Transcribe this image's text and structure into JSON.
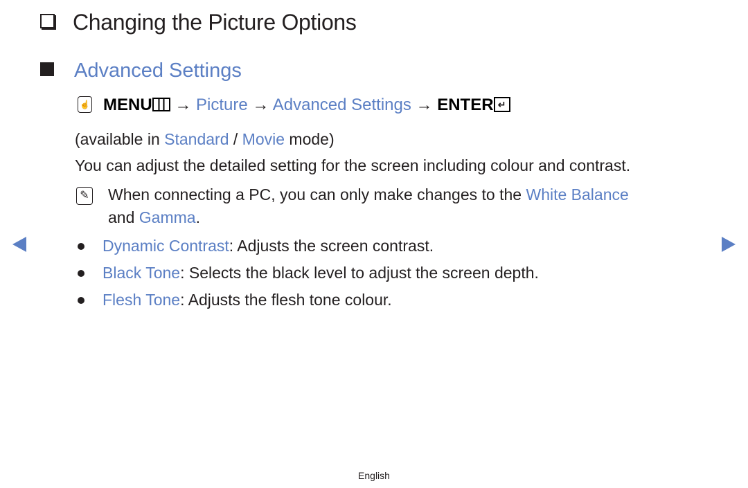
{
  "title": "Changing the Picture Options",
  "section": "Advanced Settings",
  "menu_path": {
    "menu": "MENU",
    "arrow": "→",
    "picture": "Picture",
    "advanced": "Advanced Settings",
    "enter": "ENTER",
    "enter_glyph": "↵",
    "hand_glyph": "☝"
  },
  "availability": {
    "prefix": "(available in ",
    "mode1": "Standard",
    "sep": " / ",
    "mode2": "Movie",
    "suffix": " mode)"
  },
  "description": "You can adjust the detailed setting for the screen including colour and contrast.",
  "note": {
    "icon_glyph": "✎",
    "line1_prefix": "When connecting a PC, you can only make changes to the ",
    "white_balance": "White Balance",
    "line2_prefix": "and ",
    "gamma": "Gamma",
    "line2_suffix": "."
  },
  "items": [
    {
      "term": "Dynamic Contrast",
      "text": ": Adjusts the screen contrast."
    },
    {
      "term": "Black Tone",
      "text": ": Selects the black level to adjust the screen depth."
    },
    {
      "term": "Flesh Tone",
      "text": ": Adjusts the flesh tone colour."
    }
  ],
  "footer": "English",
  "colors": {
    "accent": "#5b7fc4",
    "text": "#231f20"
  }
}
